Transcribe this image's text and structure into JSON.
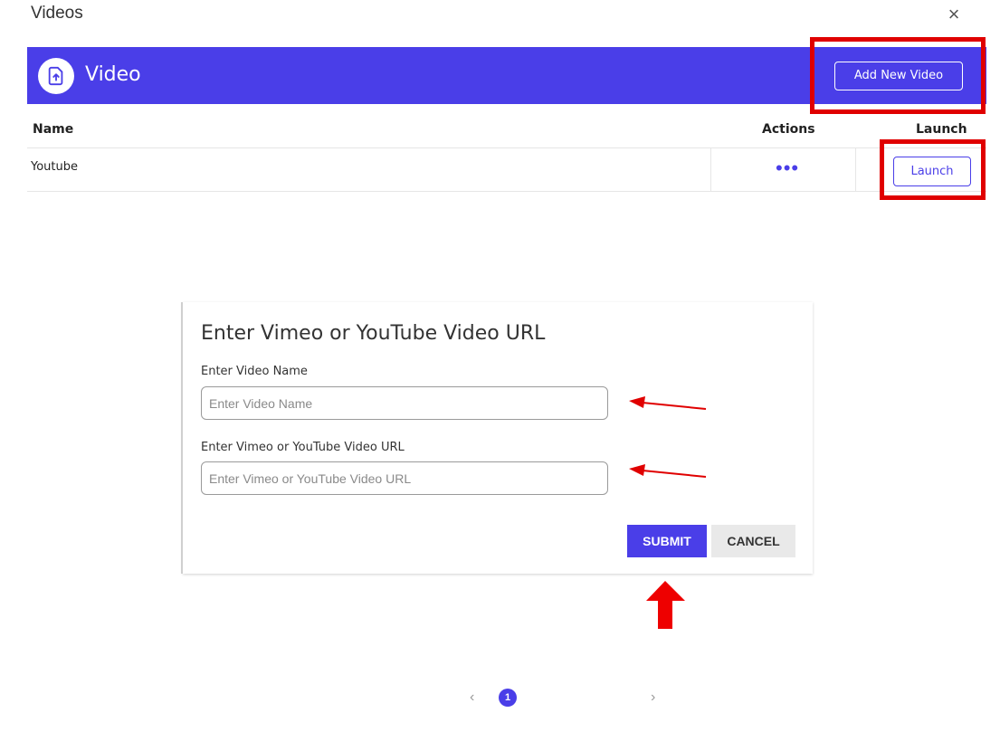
{
  "dialog": {
    "title": "Videos",
    "close_icon": "×"
  },
  "header": {
    "title": "Video",
    "icon": "file-upload-icon",
    "add_button": "Add New Video",
    "color": "#4a3ee8"
  },
  "table": {
    "columns": {
      "name": "Name",
      "actions": "Actions",
      "launch": "Launch"
    },
    "rows": [
      {
        "name": "Youtube",
        "actions": "•••",
        "launch": "Launch"
      }
    ]
  },
  "form": {
    "title": "Enter Vimeo or YouTube Video URL",
    "name_label": "Enter Video Name",
    "name_placeholder": "Enter Video Name",
    "url_label": "Enter Vimeo or YouTube Video URL",
    "url_placeholder": "Enter Vimeo or YouTube Video URL",
    "submit": "SUBMIT",
    "cancel": "CANCEL"
  },
  "pagination": {
    "prev": "‹",
    "current": "1",
    "next": "›"
  },
  "annotation_color": "#e00000"
}
